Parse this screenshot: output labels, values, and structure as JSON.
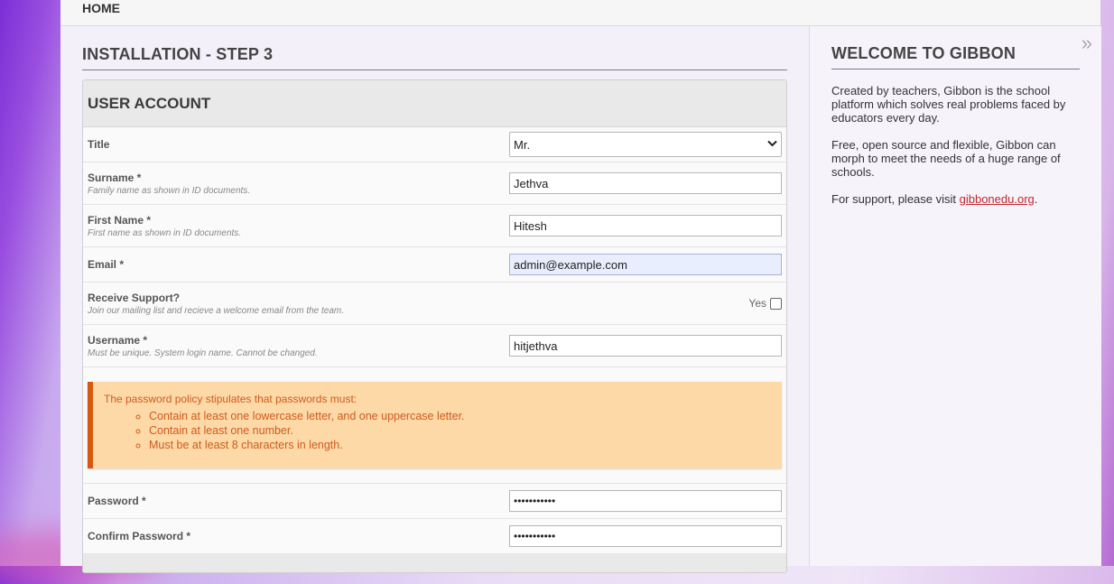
{
  "nav": {
    "home": "HOME"
  },
  "main": {
    "title": "INSTALLATION - STEP 3",
    "section": "USER ACCOUNT",
    "title_field": {
      "label": "Title",
      "value": "Mr."
    },
    "surname": {
      "label": "Surname *",
      "hint": "Family name as shown in ID documents.",
      "value": "Jethva"
    },
    "firstname": {
      "label": "First Name *",
      "hint": "First name as shown in ID documents.",
      "value": "Hitesh"
    },
    "email": {
      "label": "Email *",
      "value": "admin@example.com"
    },
    "support": {
      "label": "Receive Support?",
      "hint": "Join our mailing list and recieve a welcome email from the team.",
      "option": "Yes"
    },
    "username": {
      "label": "Username *",
      "hint": "Must be unique. System login name. Cannot be changed.",
      "value": "hitjethva"
    },
    "policy": {
      "intro": "The password policy stipulates that passwords must:",
      "items": [
        "Contain at least one lowercase letter, and one uppercase letter.",
        "Contain at least one number.",
        "Must be at least 8 characters in length."
      ]
    },
    "password": {
      "label": "Password *",
      "value": "•••••••••••"
    },
    "confirm": {
      "label": "Confirm Password *",
      "value": "•••••••••••"
    }
  },
  "sidebar": {
    "title": "WELCOME TO GIBBON",
    "collapse_glyph": "»",
    "p1": "Created by teachers, Gibbon is the school platform which solves real problems faced by educators every day.",
    "p2": "Free, open source and flexible, Gibbon can morph to meet the needs of a huge range of schools.",
    "p3_pre": "For support, please visit ",
    "p3_link": "gibbonedu.org",
    "p3_post": "."
  },
  "colors": {
    "accent_link": "#c1272d",
    "warning_bg": "#fdd9a8",
    "warning_border": "#d9580d"
  }
}
